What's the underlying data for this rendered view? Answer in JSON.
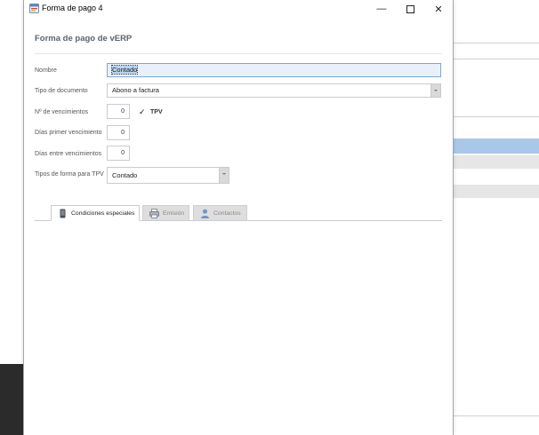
{
  "window": {
    "title": "Forma de pago 4",
    "controls": [
      "minimize",
      "maximize",
      "close"
    ]
  },
  "form": {
    "heading": "Forma de pago de vERP",
    "fields": {
      "nombre": {
        "label": "Nombre",
        "value": "Contado"
      },
      "tipo_documento": {
        "label": "Tipo de documento",
        "value": "Abono a factura"
      },
      "num_vencimientos": {
        "label": "Nº de vencimientos",
        "value": "0"
      },
      "tpv": {
        "label": "TPV",
        "checked": true
      },
      "dias_primer": {
        "label": "Días primer vencimiento",
        "value": "0"
      },
      "dias_entre": {
        "label": "Días entre vencimientos",
        "value": "0"
      },
      "tipos_forma_tpv": {
        "label": "Tipos de forma para TPV",
        "value": "Contado"
      }
    }
  },
  "tabs": [
    {
      "label": "Condiciones especiales",
      "icon": "phone-icon",
      "active": true
    },
    {
      "label": "Emisión",
      "icon": "printer-icon",
      "active": false
    },
    {
      "label": "Contactos",
      "icon": "person-icon",
      "active": false
    }
  ],
  "colors": {
    "accent": "#7aa7d6",
    "heading": "#5a6370",
    "selection_row": "#a9c8e9"
  }
}
